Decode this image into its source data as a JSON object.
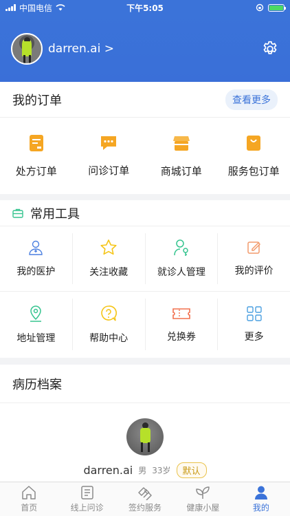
{
  "status": {
    "carrier": "中国电信",
    "time": "下午5:05"
  },
  "profile": {
    "name": "darren.ai >"
  },
  "orders": {
    "title": "我的订单",
    "more": "查看更多",
    "items": [
      {
        "label": "处方订单",
        "icon": "prescription-icon",
        "color": "#f5a623"
      },
      {
        "label": "问诊订单",
        "icon": "chat-icon",
        "color": "#f5a623"
      },
      {
        "label": "商城订单",
        "icon": "shop-icon",
        "color": "#f5a623"
      },
      {
        "label": "服务包订单",
        "icon": "bag-icon",
        "color": "#f5a623"
      }
    ]
  },
  "tools": {
    "title": "常用工具",
    "items": [
      {
        "label": "我的医护",
        "icon": "doctor-icon",
        "color": "#4a7fe0"
      },
      {
        "label": "关注收藏",
        "icon": "star-icon",
        "color": "#f5c518"
      },
      {
        "label": "就诊人管理",
        "icon": "patient-icon",
        "color": "#35c48f"
      },
      {
        "label": "我的评价",
        "icon": "edit-icon",
        "color": "#f29a6b"
      },
      {
        "label": "地址管理",
        "icon": "location-icon",
        "color": "#35c48f"
      },
      {
        "label": "帮助中心",
        "icon": "help-icon",
        "color": "#f5c518"
      },
      {
        "label": "兑换券",
        "icon": "coupon-icon",
        "color": "#f2704e"
      },
      {
        "label": "更多",
        "icon": "grid-icon",
        "color": "#4a9fe0"
      }
    ]
  },
  "records": {
    "title": "病历档案",
    "name": "darren.ai",
    "gender": "男",
    "age": "33岁",
    "badge": "默认"
  },
  "tabbar": [
    {
      "label": "首页",
      "icon": "home-icon"
    },
    {
      "label": "线上问诊",
      "icon": "consult-icon"
    },
    {
      "label": "签约服务",
      "icon": "contract-icon"
    },
    {
      "label": "健康小屋",
      "icon": "leaf-icon"
    },
    {
      "label": "我的",
      "icon": "user-icon",
      "active": true
    }
  ]
}
